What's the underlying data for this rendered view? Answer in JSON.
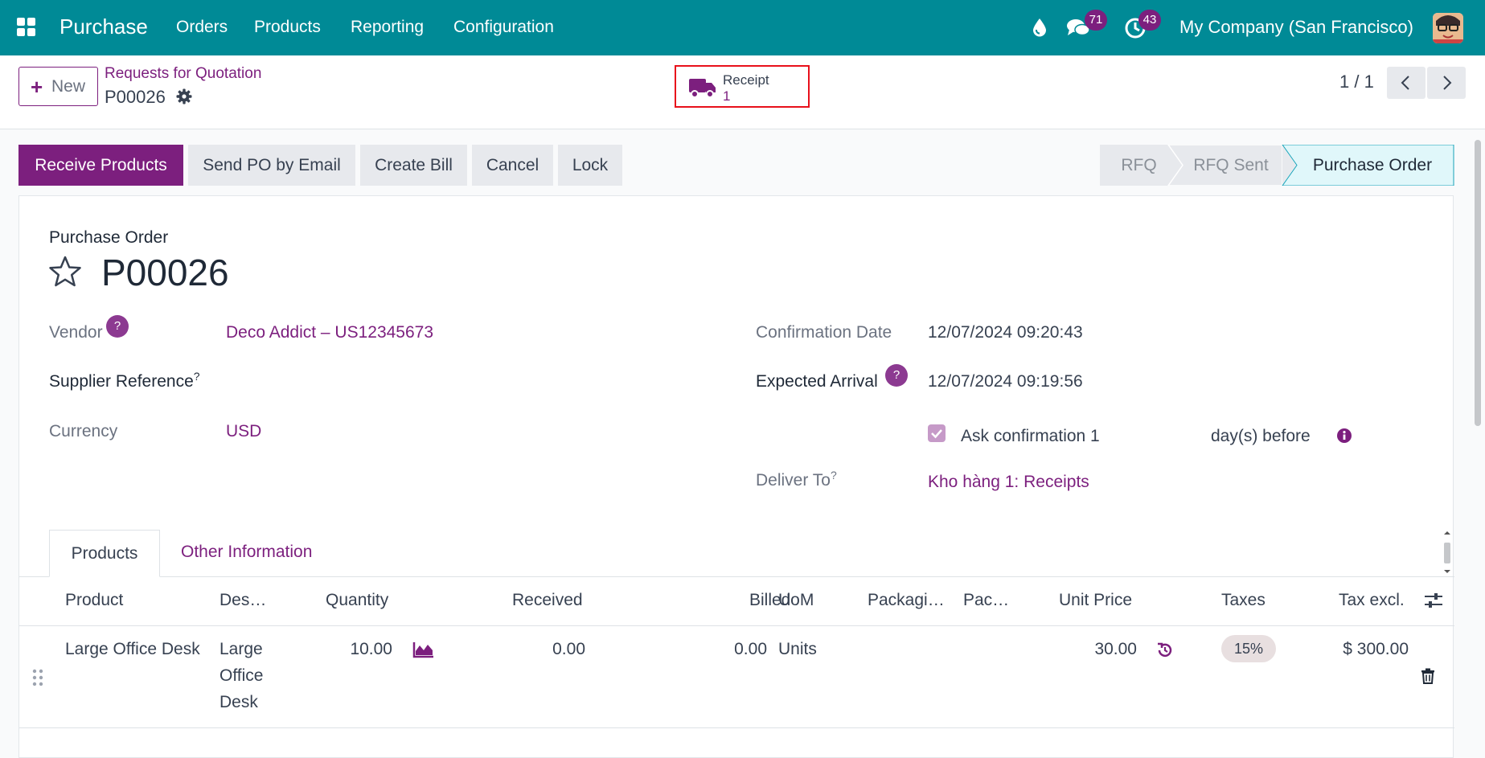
{
  "navbar": {
    "brand": "Purchase",
    "menu": [
      "Orders",
      "Products",
      "Reporting",
      "Configuration"
    ],
    "messages_count": "71",
    "activities_count": "43",
    "company": "My Company (San Francisco)"
  },
  "control_panel": {
    "new_label": "New",
    "breadcrumb_parent": "Requests for Quotation",
    "breadcrumb_current": "P00026",
    "smart_button": {
      "title": "Receipt",
      "value": "1"
    },
    "pager": "1 / 1"
  },
  "statusbar": {
    "buttons": [
      "Receive Products",
      "Send PO by Email",
      "Create Bill",
      "Cancel",
      "Lock"
    ],
    "stages": [
      "RFQ",
      "RFQ Sent",
      "Purchase Order"
    ],
    "active_stage": "Purchase Order"
  },
  "form": {
    "subtitle": "Purchase Order",
    "name": "P00026",
    "vendor_label": "Vendor",
    "vendor_help": "?",
    "vendor": "Deco Addict – US12345673",
    "supplier_ref_label": "Supplier Reference",
    "supplier_ref_help": "?",
    "currency_label": "Currency",
    "currency": "USD",
    "confirmation_date_label": "Confirmation Date",
    "confirmation_date": "12/07/2024 09:20:43",
    "expected_arrival_label": "Expected Arrival",
    "expected_arrival_help": "?",
    "expected_arrival": "12/07/2024 09:19:56",
    "ask_confirmation_label": "Ask confirmation 1",
    "ask_confirmation_checked": true,
    "days_before_label": "day(s) before",
    "deliver_to_label": "Deliver To",
    "deliver_to_help": "?",
    "deliver_to": "Kho hàng 1: Receipts"
  },
  "tabs": {
    "products": "Products",
    "other": "Other Information"
  },
  "order_lines": {
    "columns": [
      "Product",
      "Des…",
      "Quantity",
      "Received",
      "Billed",
      "UoM",
      "Packagi…",
      "Pac…",
      "Unit Price",
      "Taxes",
      "Tax excl."
    ],
    "rows": [
      {
        "product": "Large Office Desk",
        "description": [
          "Large",
          "Office",
          "Desk"
        ],
        "quantity": "10.00",
        "received": "0.00",
        "billed": "0.00",
        "uom": "Units",
        "unit_price": "30.00",
        "taxes": "15%",
        "tax_excl": "$ 300.00"
      }
    ]
  },
  "colors": {
    "navbar": "#008a96",
    "primary": "#7c1f7e",
    "highlight_border": "#e8101b",
    "active_stage_bg": "#e0f7fa"
  }
}
